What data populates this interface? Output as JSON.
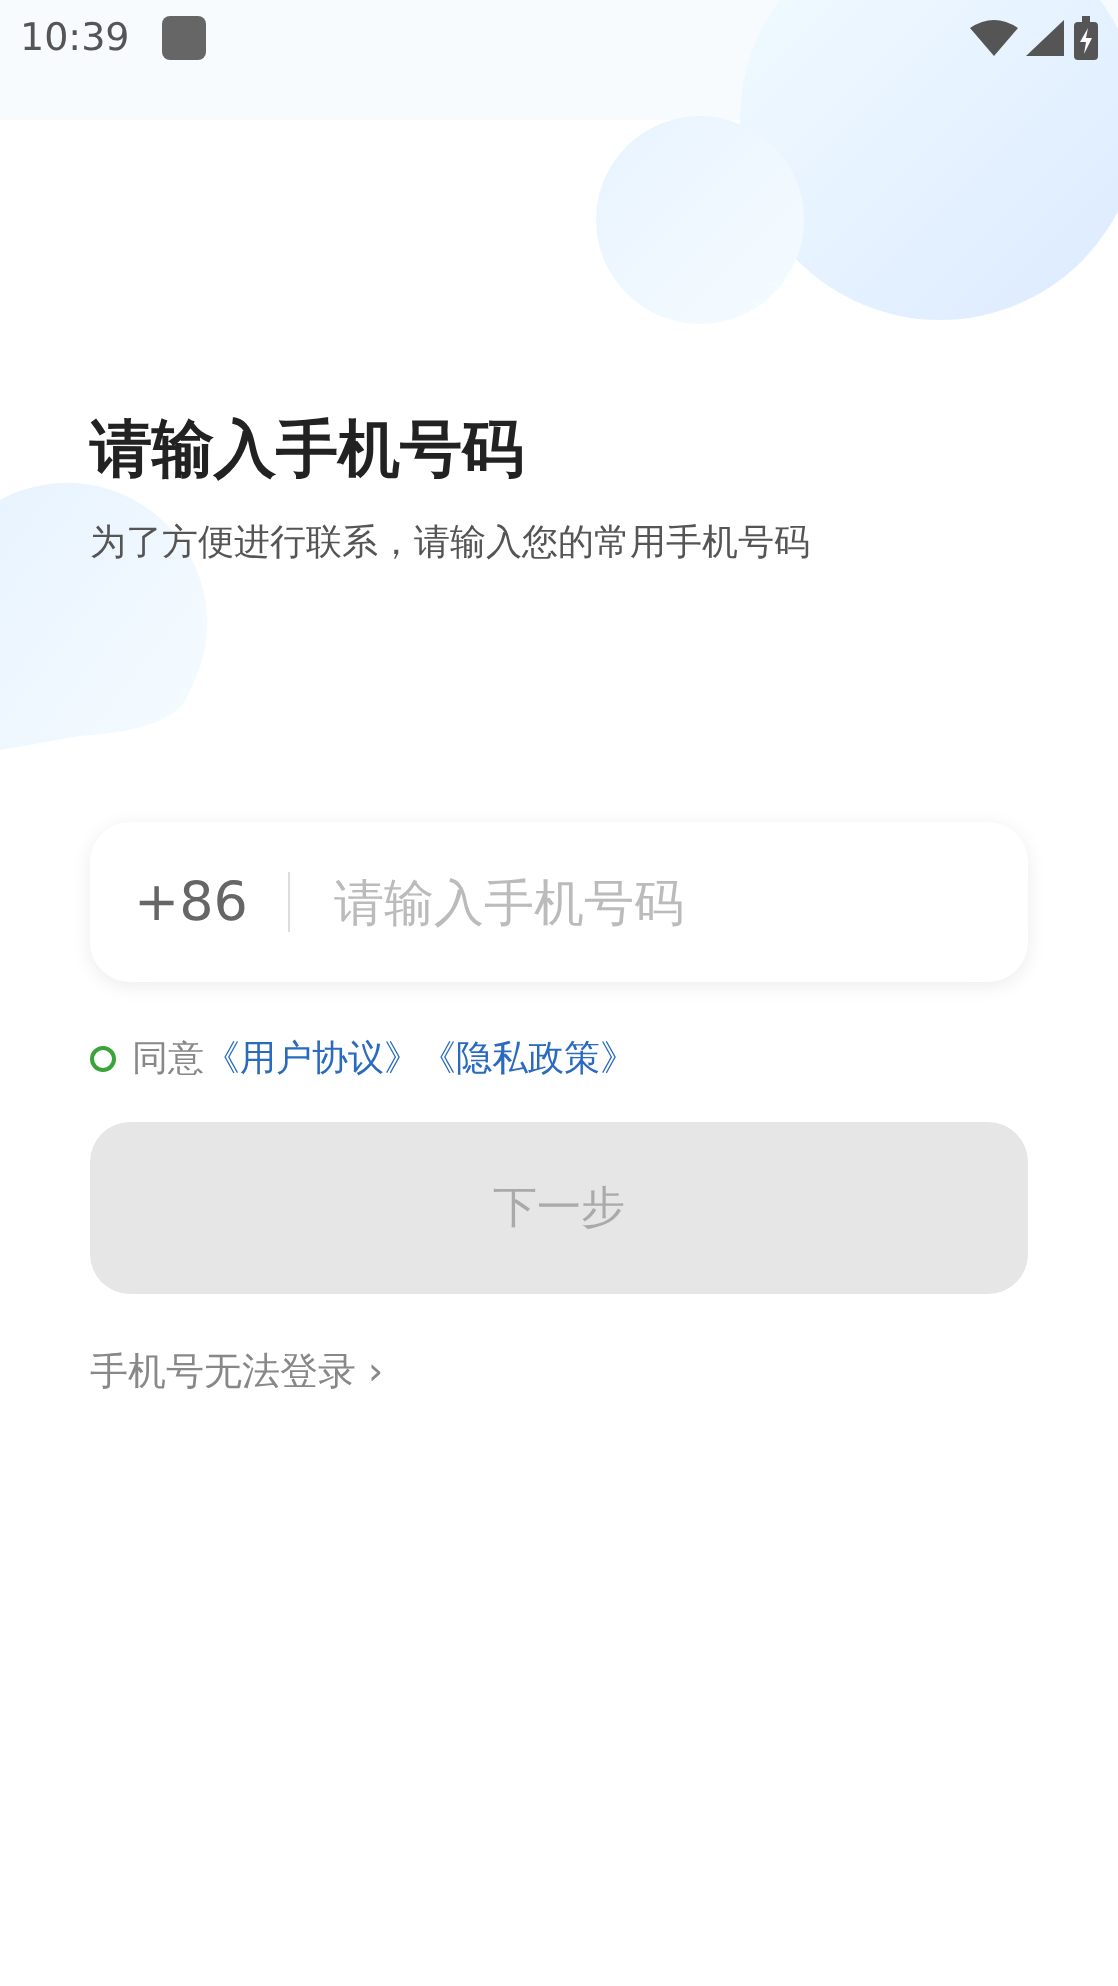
{
  "status_bar": {
    "time": "10:39"
  },
  "title": "请输入手机号码",
  "subtitle": "为了方便进行联系，请输入您的常用手机号码",
  "phone_field": {
    "country_code": "+86",
    "placeholder": "请输入手机号码"
  },
  "agreement": {
    "checked": false,
    "prefix": "同意",
    "links": [
      "《用户协议》",
      "《隐私政策》"
    ]
  },
  "next_button": {
    "label": "下一步",
    "disabled": true
  },
  "help_link": {
    "label": "手机号无法登录",
    "chevron": "›"
  }
}
